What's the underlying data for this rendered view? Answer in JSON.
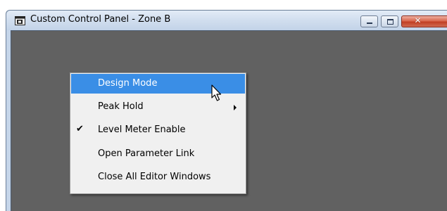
{
  "window": {
    "title": "Custom Control Panel - Zone B",
    "controls": {
      "minimize_icon": "minimize-icon",
      "maximize_icon": "maximize-icon",
      "close_label": "✕"
    }
  },
  "context_menu": {
    "items": [
      {
        "label": "Design Mode",
        "highlighted": true,
        "checked": false,
        "has_submenu": false
      },
      {
        "label": "Peak Hold",
        "highlighted": false,
        "checked": false,
        "has_submenu": true
      },
      {
        "label": "Level Meter Enable",
        "highlighted": false,
        "checked": true,
        "has_submenu": false,
        "check_glyph": "✔"
      },
      {
        "label": "Open Parameter Link",
        "highlighted": false,
        "checked": false,
        "has_submenu": false
      },
      {
        "label": "Close All Editor Windows",
        "highlighted": false,
        "checked": false,
        "has_submenu": false
      }
    ]
  },
  "colors": {
    "client_background": "#616161",
    "menu_background": "#f0f0f0",
    "menu_highlight": "#3a8ee6",
    "close_button": "#c94b32"
  }
}
